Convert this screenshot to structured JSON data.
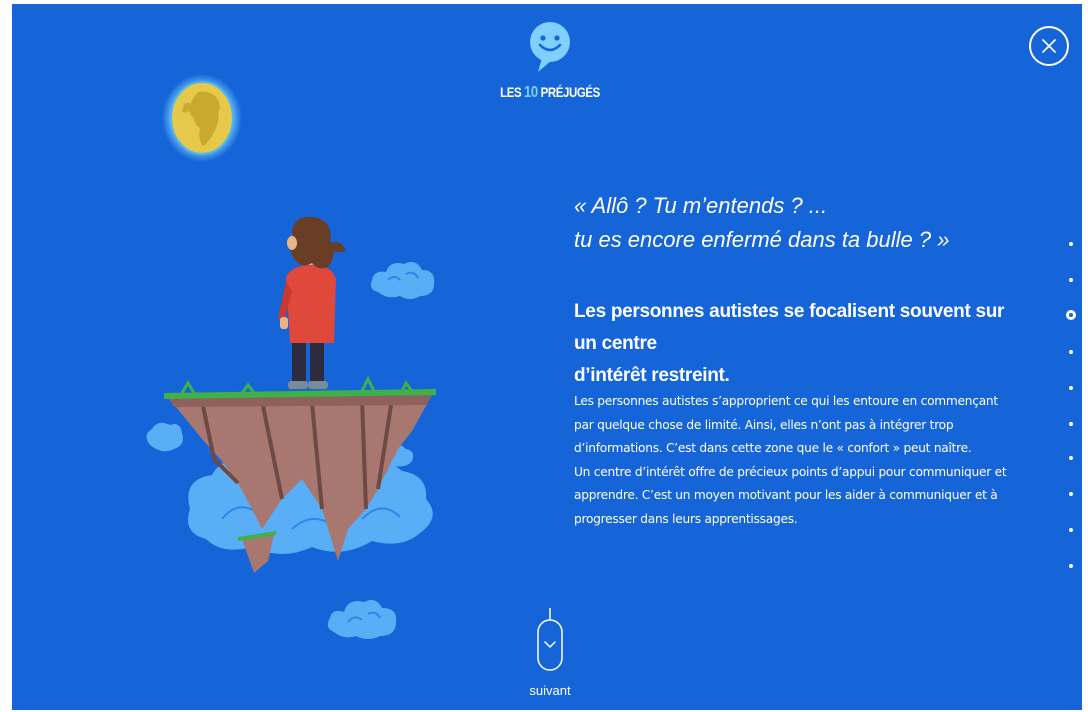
{
  "header": {
    "logo_prefix": "LES",
    "logo_number": "10",
    "logo_suffix": "PRÉJUGÉS",
    "close_label": "close"
  },
  "content": {
    "quote_line1": "« Allô ? Tu m’entends ? ...",
    "quote_line2": "tu es encore enfermé dans ta bulle ? »",
    "headline_line1": "Les personnes autistes se focalisent souvent sur un centre",
    "headline_line2": "d’intérêt restreint.",
    "body_lines": [
      "Les personnes autistes s’approprient ce qui les entoure en commençant",
      "par quelque chose de limité. Ainsi, elles n’ont pas à intégrer trop",
      "d’informations. C’est dans cette zone que le « confort » peut naître.",
      "Un centre d’intérêt offre de précieux points d’appui pour communiquer et",
      "apprendre. C’est un moyen motivant pour les aider à communiquer et à",
      "progresser dans leurs apprentissages."
    ]
  },
  "navigation": {
    "slide_count": 10,
    "active_index": 2,
    "next_label": "suivant"
  },
  "icons": {
    "logo": "smiley-speech-bubble-icon",
    "close": "close-icon",
    "next": "chevron-down-icon",
    "moon": "earth-moon-icon"
  },
  "colors": {
    "background": "#1565d8",
    "text": "#ffffff",
    "accent": "#7fd0ff"
  }
}
